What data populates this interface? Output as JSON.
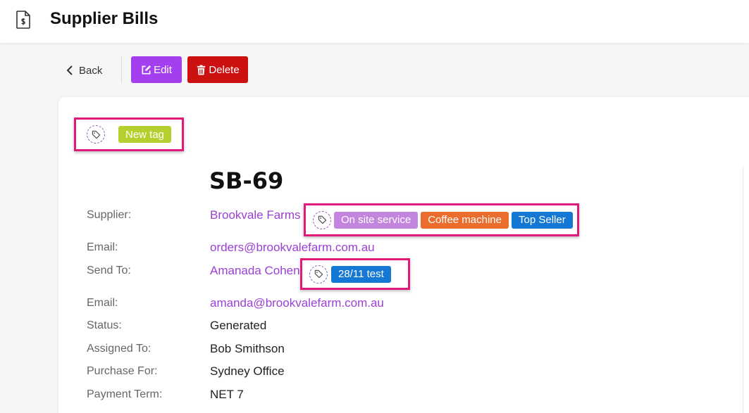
{
  "header": {
    "title": "Supplier Bills",
    "icon": "invoice-dollar-icon"
  },
  "toolbar": {
    "back_label": "Back",
    "edit_label": "Edit",
    "delete_label": "Delete"
  },
  "bill": {
    "tags": [
      {
        "label": "New tag",
        "color": "#b4cf2e"
      }
    ],
    "id": "SB-69",
    "supplier_label": "Supplier:",
    "supplier": "Brookvale Farms",
    "supplier_tags": [
      {
        "label": "On site service",
        "color": "#c385dd"
      },
      {
        "label": "Coffee machine",
        "color": "#ea6d2e"
      },
      {
        "label": "Top Seller",
        "color": "#1478d4"
      }
    ],
    "supplier_email_label": "Email:",
    "supplier_email": "orders@brookvalefarm.com.au",
    "send_to_label": "Send To:",
    "send_to": "Amanada Cohen",
    "send_to_tags": [
      {
        "label": "28/11 test",
        "color": "#1478d4"
      }
    ],
    "send_to_email_label": "Email:",
    "send_to_email": "amanda@brookvalefarm.com.au",
    "status_label": "Status:",
    "status": "Generated",
    "assigned_label": "Assigned To:",
    "assigned": "Bob Smithson",
    "purchase_for_label": "Purchase For:",
    "purchase_for": "Sydney Office",
    "payment_term_label": "Payment Term:",
    "payment_term": "NET 7"
  },
  "colors": {
    "accent": "#a43ff0",
    "danger": "#cc1111",
    "highlight": "#e0197a",
    "link": "#9b3fd6"
  }
}
